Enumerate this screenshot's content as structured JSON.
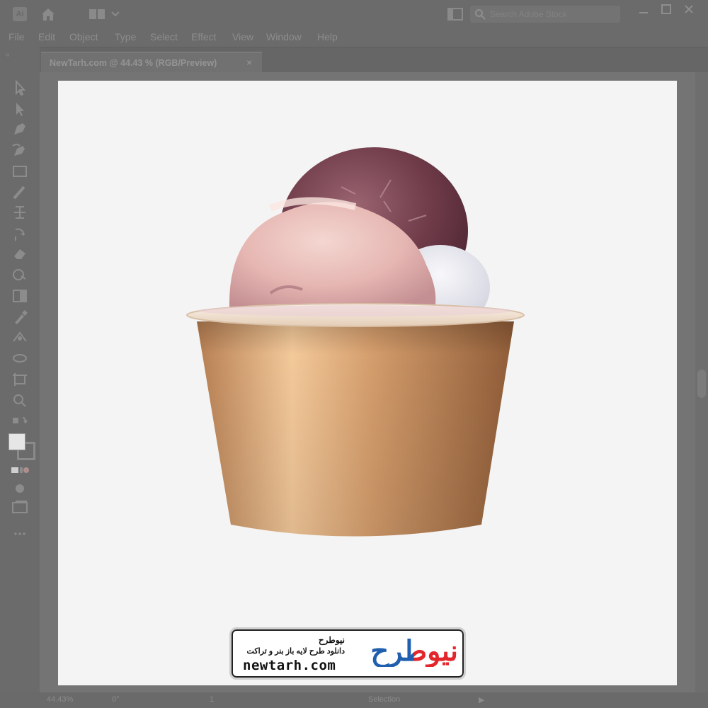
{
  "app": {
    "logo_text": "Ai",
    "search_placeholder": "Search Adobe Stock"
  },
  "menu": [
    "File",
    "Edit",
    "Object",
    "Type",
    "Select",
    "Effect",
    "View",
    "Window",
    "Help"
  ],
  "document_tab": {
    "title": "NewTarh.com @ 44.43 % (RGB/Preview)",
    "close": "×"
  },
  "status": {
    "zoom": "44.43%",
    "rotation": "0°",
    "artboard": "1",
    "mode": "Selection"
  },
  "watermark": {
    "persian_name": "نیوطرح",
    "persian_tagline": "دانلود طرح لایه باز بنر و تراکت",
    "url": "newtarh.com",
    "logo_text": "نیوطرح",
    "colors": {
      "red": "#e3262b",
      "blue": "#1f5fae"
    }
  },
  "tools": [
    "selection-tool",
    "direct-selection-tool",
    "pen-tool",
    "curvature-tool",
    "rectangle-tool",
    "paintbrush-tool",
    "type-tool",
    "rotate-tool",
    "eraser-tool",
    "shape-builder-tool",
    "gradient-tool",
    "eyedropper-tool",
    "blend-tool",
    "symbol-sprayer-tool",
    "artboard-tool",
    "zoom-tool",
    "swap-fill-stroke",
    "fill-stroke-swatch",
    "color-mode-toggle",
    "draw-mode",
    "screen-mode",
    "more-tools"
  ]
}
